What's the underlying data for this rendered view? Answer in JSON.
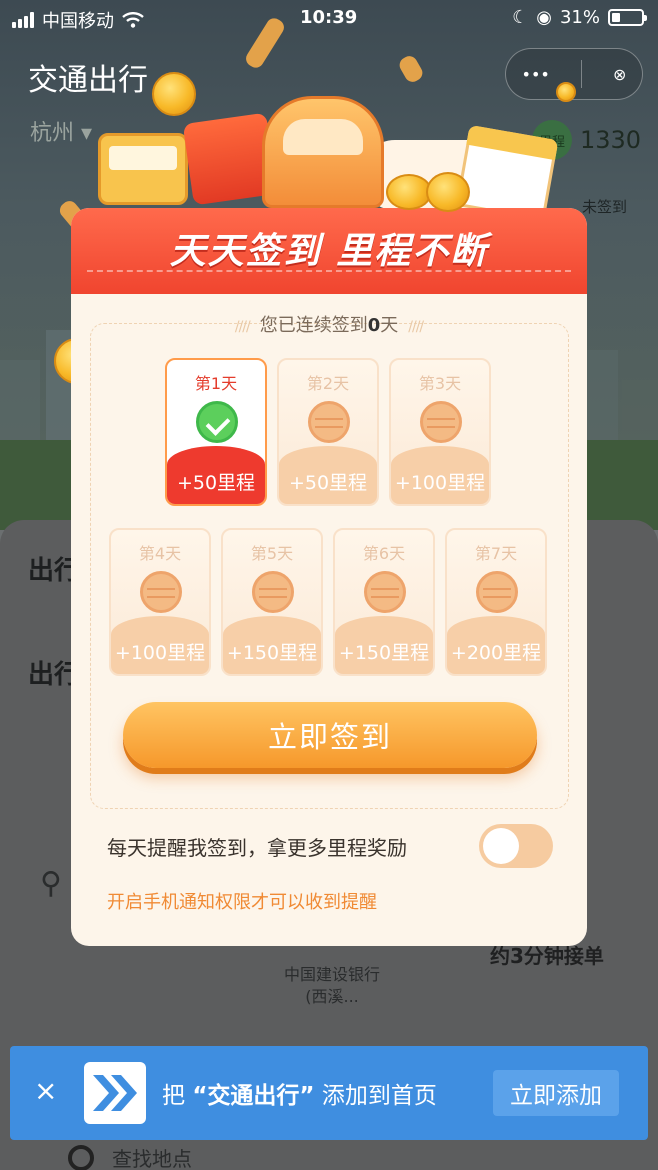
{
  "status_bar": {
    "carrier": "中国移动",
    "time": "10:39",
    "battery": "31%"
  },
  "app": {
    "title": "交通出行",
    "city": "杭州",
    "miles_badge": "里程",
    "miles_value": "1330",
    "unsigned": "未签到"
  },
  "background": {
    "row1": "出行",
    "row2": "出行",
    "wait": "约3分钟接单",
    "bank": "中国建设银行(西溪...",
    "search": "查找地点"
  },
  "modal": {
    "title": "天天签到 里程不断",
    "streak_prefix": "您已连续签到",
    "streak_days": "0",
    "streak_suffix": "天",
    "deco": "////",
    "days": [
      {
        "label": "第1天",
        "reward": "+50里程",
        "checked": true
      },
      {
        "label": "第2天",
        "reward": "+50里程",
        "checked": false
      },
      {
        "label": "第3天",
        "reward": "+100里程",
        "checked": false
      },
      {
        "label": "第4天",
        "reward": "+100里程",
        "checked": false
      },
      {
        "label": "第5天",
        "reward": "+150里程",
        "checked": false
      },
      {
        "label": "第6天",
        "reward": "+150里程",
        "checked": false
      },
      {
        "label": "第7天",
        "reward": "+200里程",
        "checked": false
      }
    ],
    "sign_button": "立即签到",
    "remind_text": "每天提醒我签到，拿更多里程奖励",
    "remind_on": false,
    "hint": "开启手机通知权限才可以收到提醒"
  },
  "banner": {
    "close": "×",
    "prefix": "把",
    "name": "“交通出行”",
    "suffix": "添加到首页",
    "button": "立即添加"
  },
  "colors": {
    "header_red": "#f0452f",
    "button_orange": "#f6982b",
    "banner_blue": "#3f8ee0",
    "hint_orange": "#f08a34"
  },
  "icons": {
    "close": "close-icon",
    "check": "check-icon",
    "coin": "coin-icon",
    "logo": "double-chevron-icon"
  }
}
